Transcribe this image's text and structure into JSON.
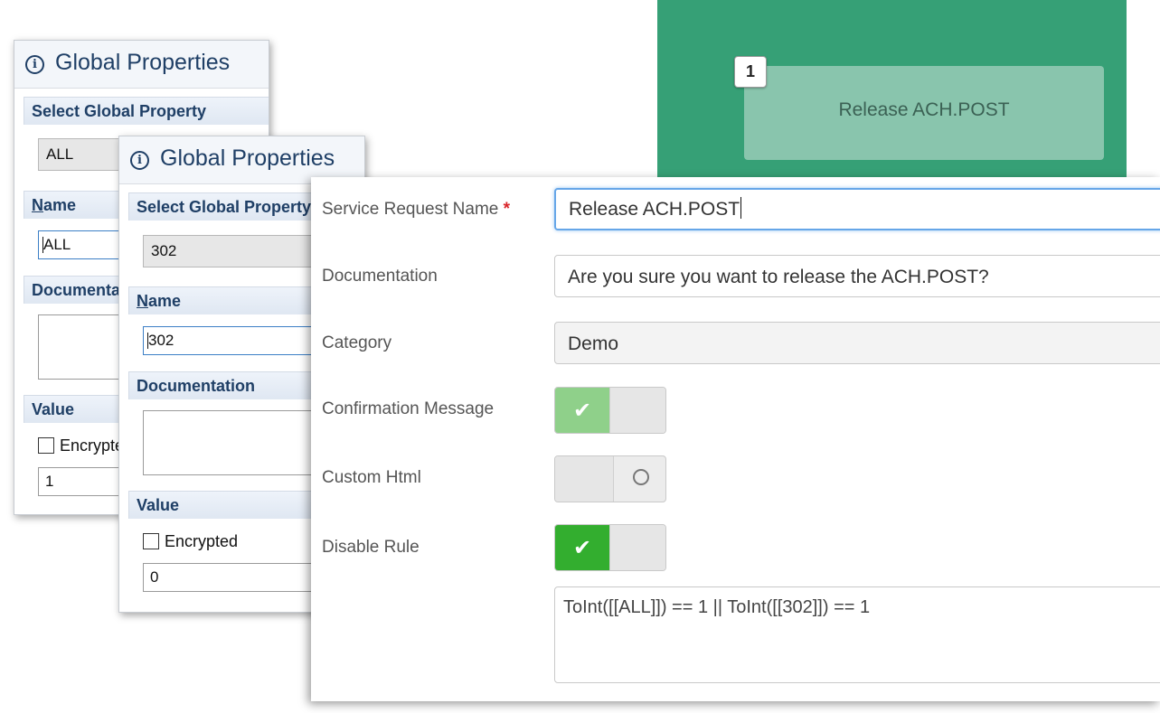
{
  "global_properties_1": {
    "title": "Global Properties",
    "select_label": "Select Global Property",
    "selected_value": "ALL",
    "name_label_underlined": "N",
    "name_label_rest": "ame",
    "name_value": "ALL",
    "documentation_label": "Documentation",
    "value_label": "Value",
    "encrypted_label": "Encrypted",
    "value": "1"
  },
  "global_properties_2": {
    "title": "Global Properties",
    "select_label": "Select Global Property",
    "selected_value": "302",
    "name_label_underlined": "N",
    "name_label_rest": "ame",
    "name_value": "302",
    "documentation_label": "Documentation",
    "value_label": "Value",
    "encrypted_label": "Encrypted",
    "value": "0"
  },
  "preview": {
    "badge": "1",
    "tile_label": "Release ACH.POST",
    "background_color": "#36a076"
  },
  "service_request": {
    "name_label": "Service Request Name",
    "required_marker": "*",
    "name_value": "Release ACH.POST",
    "documentation_label": "Documentation",
    "documentation_value": "Are you sure you want to release the ACH.POST?",
    "category_label": "Category",
    "category_value": "Demo",
    "confirmation_label": "Confirmation Message",
    "confirmation_enabled": true,
    "custom_html_label": "Custom Html",
    "custom_html_enabled": false,
    "disable_rule_label": "Disable Rule",
    "disable_rule_enabled": true,
    "disable_rule_expression": "ToInt([[ALL]]) == 1 || ToInt([[302]]) == 1"
  },
  "colors": {
    "toggle_on_light": "#8fd08a",
    "toggle_on_dark": "#33ae2f",
    "title_blue": "#1f3f66"
  }
}
